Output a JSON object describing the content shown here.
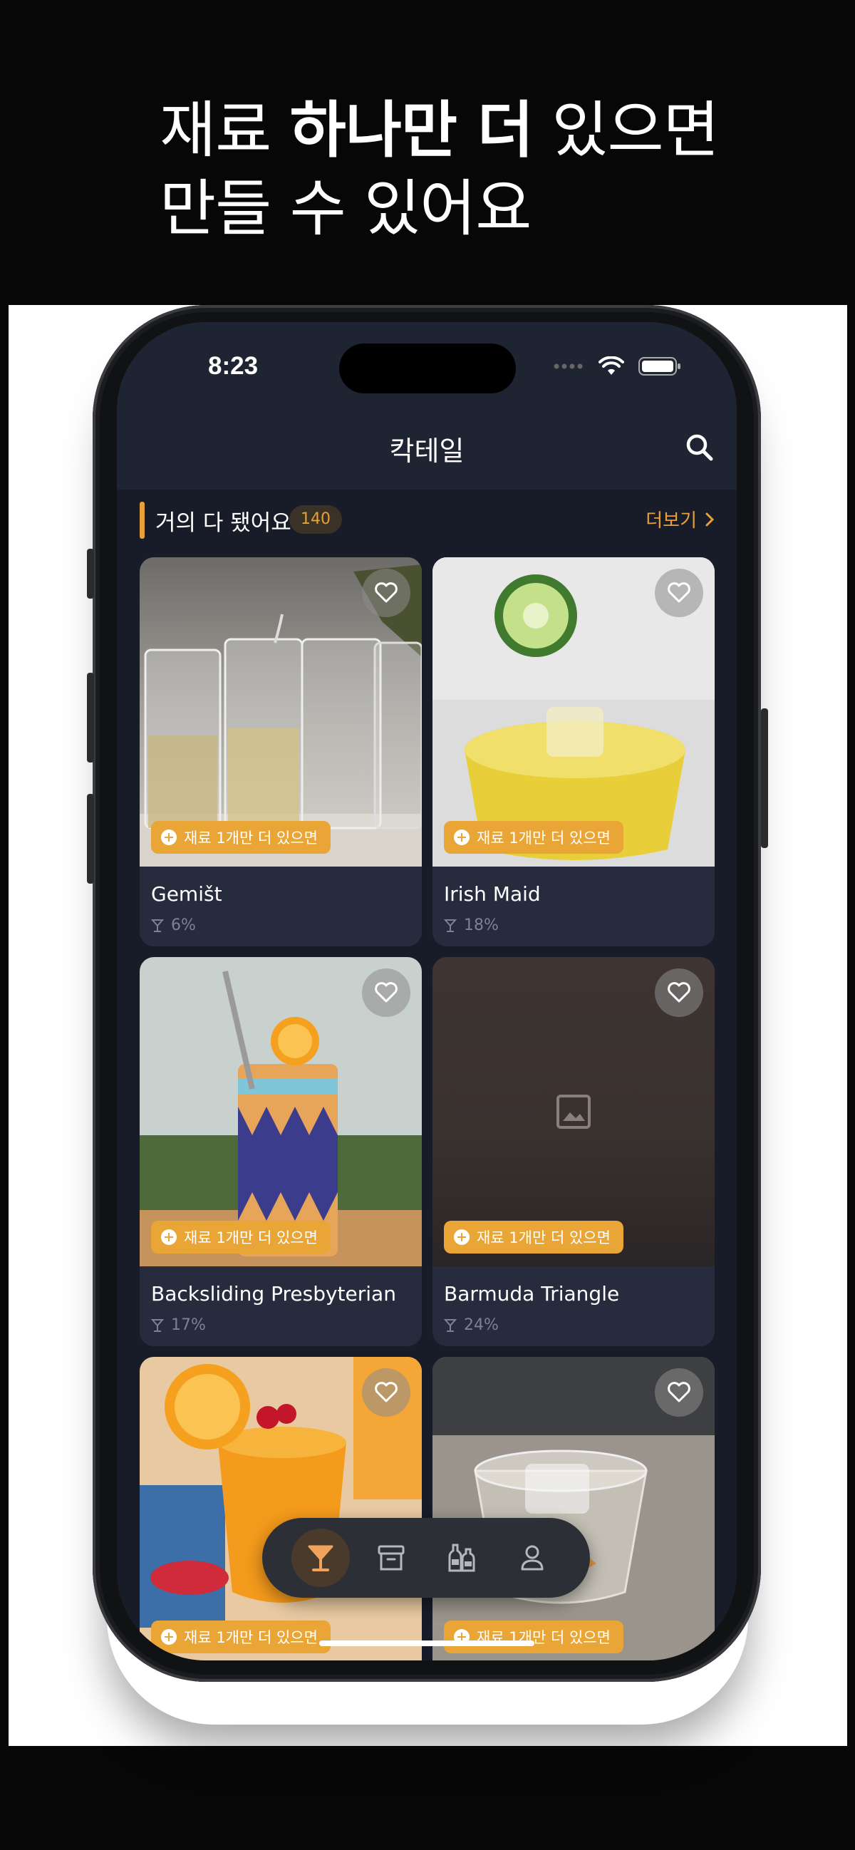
{
  "promo": {
    "line1_pre": "재료 ",
    "line1_bold": "하나만 더",
    "line1_post": " 있으면",
    "line2": "만들 수 있어요"
  },
  "status_bar": {
    "time": "8:23"
  },
  "nav": {
    "title": "칵테일",
    "search_icon": "search-icon"
  },
  "section": {
    "title": "거의 다 됐어요",
    "count": "140",
    "more_label": "더보기"
  },
  "cards": [
    {
      "name": "Gemišt",
      "abv": "6%",
      "badge": "재료 1개만 더 있으면"
    },
    {
      "name": "Irish Maid",
      "abv": "18%",
      "badge": "재료 1개만 더 있으면"
    },
    {
      "name": "Backsliding Presbyterian",
      "abv": "17%",
      "badge": "재료 1개만 더 있으면"
    },
    {
      "name": "Barmuda Triangle",
      "abv": "24%",
      "badge": "재료 1개만 더 있으면"
    },
    {
      "badge": "재료 1개만 더 있으면"
    },
    {
      "badge": "재료 1개만 더 있으면"
    }
  ],
  "tab_bar": {
    "tabs": [
      {
        "icon": "cocktail-icon",
        "active": true
      },
      {
        "icon": "archive-icon",
        "active": false
      },
      {
        "icon": "bottles-icon",
        "active": false
      },
      {
        "icon": "profile-icon",
        "active": false
      }
    ]
  },
  "colors": {
    "accent": "#e8a13a",
    "background": "#181c28",
    "card": "#262c3d"
  }
}
